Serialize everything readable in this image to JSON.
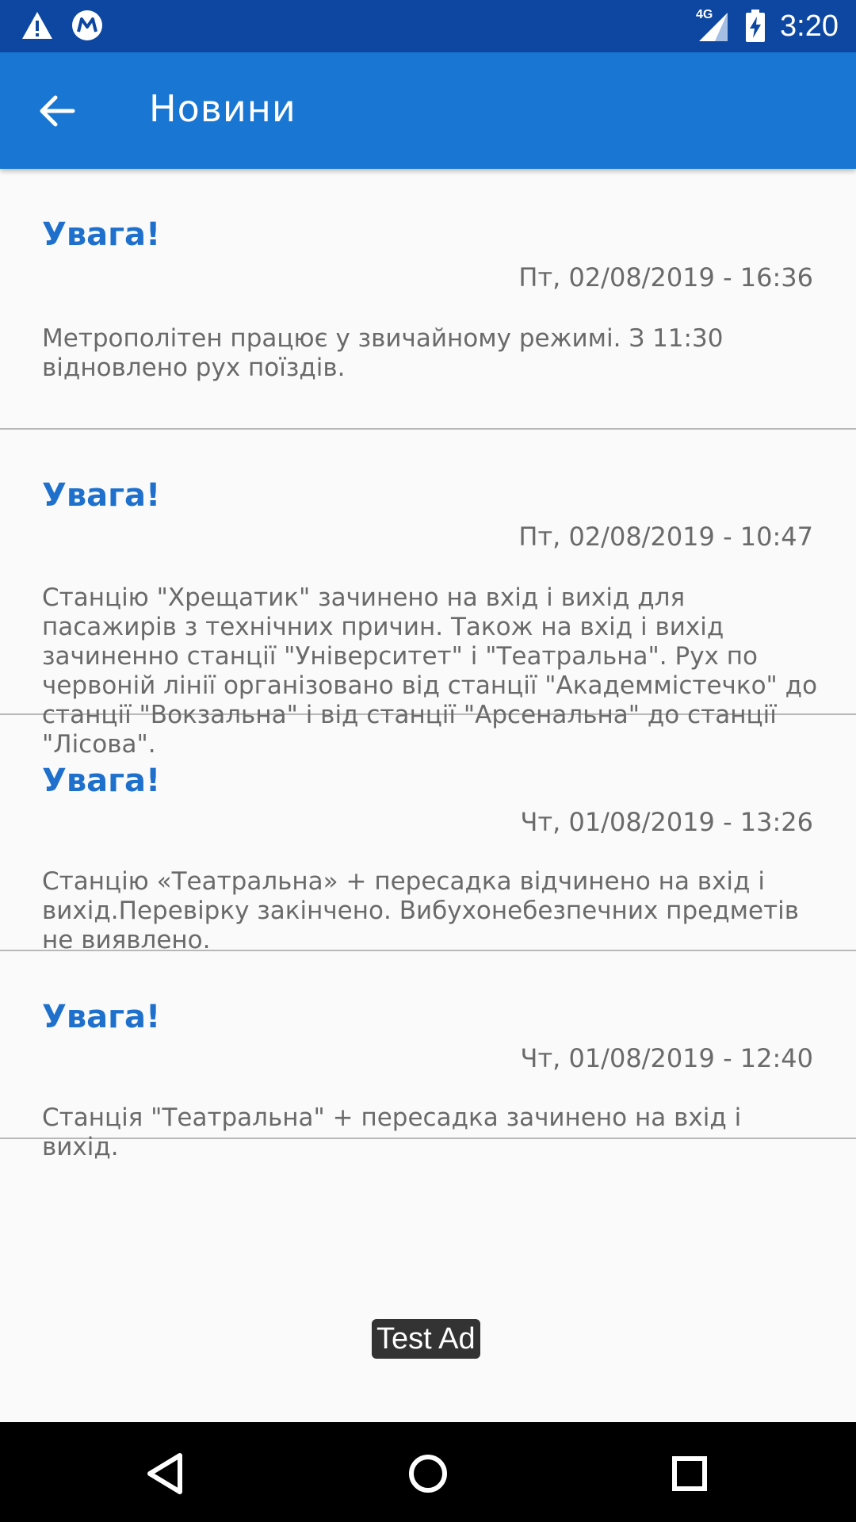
{
  "status_bar": {
    "time": "3:20",
    "network": "4G",
    "icons": [
      "warning-icon",
      "metro-logo-icon",
      "signal-icon",
      "battery-charging-icon"
    ]
  },
  "app_bar": {
    "title": "Новини",
    "back_icon": "arrow-back-icon"
  },
  "news": [
    {
      "title": "Увага!",
      "date": "Пт, 02/08/2019 - 16:36",
      "text": "Метрополітен працює у звичайному режимі. З 11:30 відновлено рух поїздів."
    },
    {
      "title": "Увага!",
      "date": "Пт, 02/08/2019 - 10:47",
      "text": "Станцію \"Хрещатик\" зачинено на вхід і вихід для пасажирів з технічних причин. Також на вхід і вихід зачиненно станції \"Університет\" і \"Театральна\". Рух по червоній лінії організовано від станції \"Академмістечко\" до станції \"Вокзальна\" і від станції \"Арсенальна\" до станції \"Лісова\"."
    },
    {
      "title": "Увага!",
      "date": "Чт, 01/08/2019 - 13:26",
      "text": "Станцію «Театральна» + пересадка відчинено на вхід і вихід.Перевірку закінчено. Вибухонебезпечних предметів не виявлено."
    },
    {
      "title": "Увага!",
      "date": "Чт, 01/08/2019 - 12:40",
      "text": "Станція \"Театральна\" + пересадка зачинено на вхід і вихід."
    }
  ],
  "ad": {
    "label": "Test Ad"
  },
  "nav_bar": {
    "icons": [
      "back-triangle-icon",
      "home-circle-icon",
      "recents-square-icon"
    ]
  }
}
